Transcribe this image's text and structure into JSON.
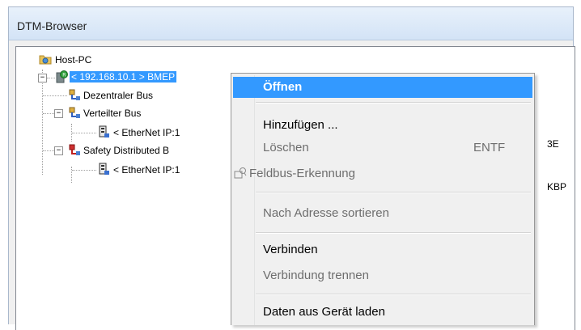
{
  "window": {
    "title": "DTM-Browser"
  },
  "tree": {
    "root": "Host-PC",
    "selected": "< 192.168.10.1 > BMEP",
    "dezentral": "Dezentraler Bus",
    "verteilter": "Verteilter Bus",
    "ethernet1": "< EtherNet IP:1",
    "safety": "Safety Distributed B",
    "ethernet2": "< EtherNet IP:1",
    "clipped1": "3E",
    "clipped2": "KBP"
  },
  "menu": {
    "open": "Öffnen",
    "add": "Hinzufügen ...",
    "delete": "Löschen",
    "delete_shortcut": "ENTF",
    "fieldbus": "Feldbus-Erkennung",
    "sort": "Nach Adresse sortieren",
    "connect": "Verbinden",
    "disconnect": "Verbindung trennen",
    "load": "Daten aus Gerät laden"
  },
  "colors": {
    "selection": "#3399ff"
  }
}
